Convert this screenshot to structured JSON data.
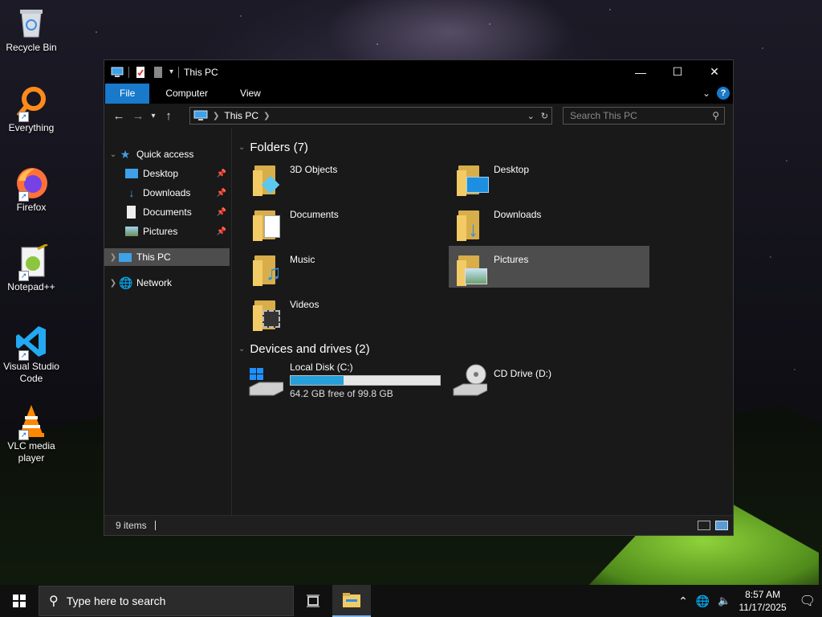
{
  "desktop": {
    "icons": [
      {
        "label": "Recycle Bin"
      },
      {
        "label": "Everything"
      },
      {
        "label": "Firefox"
      },
      {
        "label": "Notepad++"
      },
      {
        "label": "Visual Studio Code"
      },
      {
        "label": "VLC media player"
      }
    ]
  },
  "window": {
    "title": "This PC",
    "tabs": {
      "file": "File",
      "computer": "Computer",
      "view": "View"
    },
    "help": "?",
    "address": {
      "path": "This PC"
    },
    "search": {
      "placeholder": "Search This PC"
    },
    "nav": {
      "quick_access": "Quick access",
      "desktop": "Desktop",
      "downloads": "Downloads",
      "documents": "Documents",
      "pictures": "Pictures",
      "this_pc": "This PC",
      "network": "Network"
    },
    "folders_header": "Folders (7)",
    "folders": [
      {
        "label": "3D Objects"
      },
      {
        "label": "Desktop"
      },
      {
        "label": "Documents"
      },
      {
        "label": "Downloads"
      },
      {
        "label": "Music"
      },
      {
        "label": "Pictures"
      },
      {
        "label": "Videos"
      }
    ],
    "devices_header": "Devices and drives (2)",
    "drives": [
      {
        "label": "Local Disk (C:)",
        "free_text": "64.2 GB free of 99.8 GB",
        "used_fraction": 0.357
      },
      {
        "label": "CD Drive (D:)"
      }
    ],
    "status": "9 items"
  },
  "taskbar": {
    "search_placeholder": "Type here to search",
    "time": "8:57 AM",
    "date": "11/17/2025"
  },
  "colors": {
    "accent": "#1979ca",
    "selection": "#4d4d4d",
    "drive_bar": "#26a0da"
  }
}
